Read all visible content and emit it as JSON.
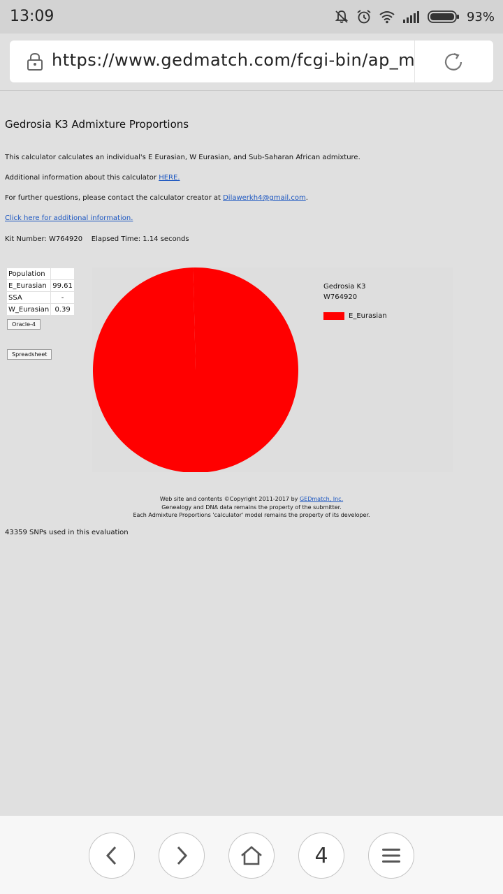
{
  "status_bar": {
    "time": "13:09",
    "battery": "93%",
    "icons": [
      "mute-bell-icon",
      "alarm-icon",
      "wifi-icon",
      "signal-icon",
      "battery-icon"
    ]
  },
  "browser": {
    "url": "https://www.gedmatch.com/fcgi-bin/ap_mi",
    "lock_icon": "lock-icon",
    "reload_icon": "reload-icon"
  },
  "page": {
    "title": "Gedrosia K3 Admixture Proportions",
    "description": "This calculator calculates an individual's E Eurasian, W Eurasian, and Sub-Saharan African admixture.",
    "additional_info_prefix": "Additional information about this calculator",
    "additional_info_link": "HERE.",
    "contact_prefix": "For further questions, please contact the calculator creator at",
    "contact_email": "Dilawerkh4@gmail.com",
    "contact_suffix": ".",
    "click_here_link": "Click here for additional information.",
    "kit_label": "Kit Number:",
    "kit_number": "W764920",
    "elapsed_label": "Elapsed Time:",
    "elapsed_time": "1.14 seconds"
  },
  "population_table": {
    "header": "Population",
    "rows": [
      {
        "name": "E_Eurasian",
        "value": "99.61"
      },
      {
        "name": "SSA",
        "value": "-"
      },
      {
        "name": "W_Eurasian",
        "value": "0.39"
      }
    ]
  },
  "buttons": {
    "oracle": "Oracle-4",
    "spreadsheet": "Spreadsheet"
  },
  "chart_data": {
    "type": "pie",
    "title": "Gedrosia K3",
    "subtitle": "W764920",
    "slices": [
      {
        "label": "E_Eurasian",
        "value": 99.61,
        "color": "#ff0000"
      },
      {
        "label": "W_Eurasian",
        "value": 0.39,
        "color": "#ff0000"
      }
    ],
    "legend": [
      "E_Eurasian"
    ],
    "legend_placement": "right"
  },
  "footer": {
    "line1_prefix": "Web site and contents ©Copyright 2011-2017 by",
    "line1_link": "GEDmatch, Inc.",
    "line2": "Genealogy and DNA data remains the property of the submitter.",
    "line3": "Each Admixture Proportions 'calculator' model remains the property of its developer."
  },
  "snps_text": "43359 SNPs used in this evaluation",
  "bottom_nav": {
    "tab_count": "4",
    "icons": [
      "back-icon",
      "forward-icon",
      "home-icon",
      "tabs-icon",
      "menu-icon"
    ]
  }
}
